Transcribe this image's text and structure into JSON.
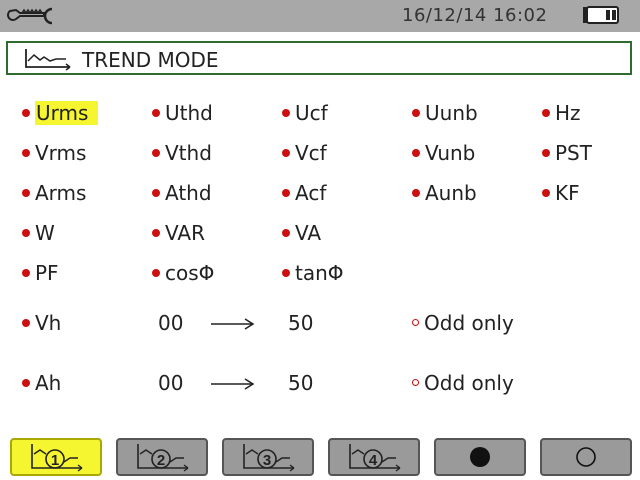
{
  "statusbar": {
    "datetime": "16/12/14  16:02",
    "tool_icon": "wrench-icon",
    "battery_icon": "battery-icon"
  },
  "title": {
    "icon": "trend-chart-icon",
    "text": "TREND MODE"
  },
  "params": {
    "row1": [
      "Urms",
      "Uthd",
      "Ucf",
      "Uunb",
      "Hz"
    ],
    "row2": [
      "Vrms",
      "Vthd",
      "Vcf",
      "Vunb",
      "PST"
    ],
    "row3": [
      "Arms",
      "Athd",
      "Acf",
      "Aunb",
      "KF"
    ],
    "row4": [
      "W",
      "VAR",
      "VA"
    ],
    "row5": [
      "PF",
      "cosΦ",
      "tanΦ"
    ]
  },
  "harmonics": [
    {
      "label": "Vh",
      "from": "00",
      "to": "50",
      "option": "Odd only"
    },
    {
      "label": "Ah",
      "from": "00",
      "to": "50",
      "option": "Odd only"
    }
  ],
  "selected_param": "Urms",
  "buttons": [
    {
      "name": "config-1",
      "number": "1",
      "active": true
    },
    {
      "name": "config-2",
      "number": "2",
      "active": false
    },
    {
      "name": "config-3",
      "number": "3",
      "active": false
    },
    {
      "name": "config-4",
      "number": "4",
      "active": false
    },
    {
      "name": "select-all",
      "icon": "filled-circle-icon"
    },
    {
      "name": "deselect-all",
      "icon": "empty-circle-icon"
    }
  ],
  "colors": {
    "statusbar": "#a8a8a8",
    "accent_red": "#cc1010",
    "highlight": "#f5f530",
    "frame_green": "#2f6a2f"
  }
}
